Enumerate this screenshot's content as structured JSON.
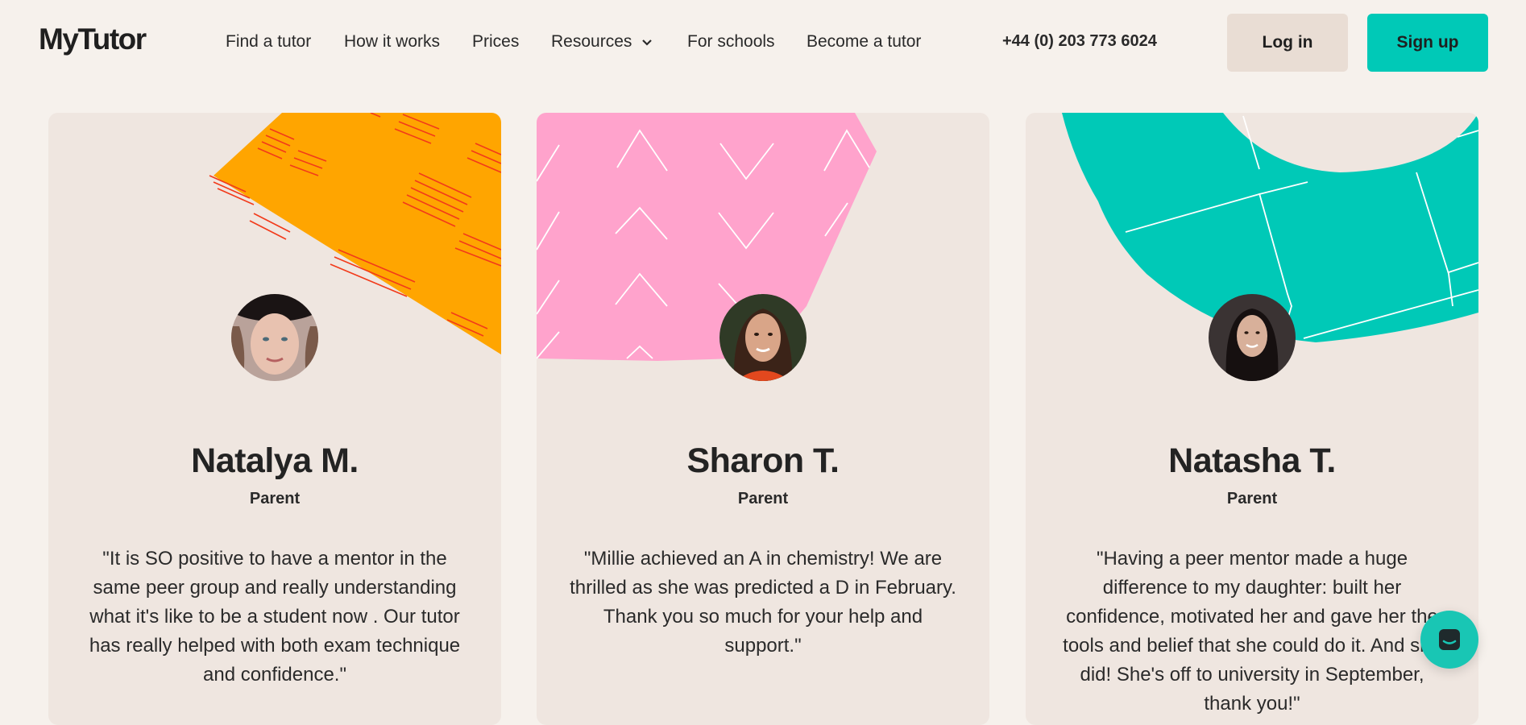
{
  "header": {
    "logo": "MyTutor",
    "nav": [
      {
        "label": "Find a tutor"
      },
      {
        "label": "How it works"
      },
      {
        "label": "Prices"
      },
      {
        "label": "Resources"
      },
      {
        "label": "For schools"
      },
      {
        "label": "Become a tutor"
      }
    ],
    "phone": "+44 (0) 203 773 6024",
    "login_label": "Log in",
    "signup_label": "Sign up"
  },
  "testimonials": [
    {
      "name": "Natalya M.",
      "role": "Parent",
      "quote": "\"It is SO positive to have a mentor in the same peer group and really understanding what it's like to be a student now . Our tutor has really helped with both exam technique and confidence.\"",
      "accent": "#ffa500"
    },
    {
      "name": "Sharon T.",
      "role": "Parent",
      "quote": "\"Millie achieved an A in chemistry! We are thrilled as she was predicted a D in February. Thank you so much for your help and support.\"",
      "accent": "#ffa3cc"
    },
    {
      "name": "Natasha T.",
      "role": "Parent",
      "quote": "\"Having a peer mentor made a huge difference to my daughter: built her confidence, motivated her and gave her the tools and belief that she could do it. And she did! She's off to university in September, thank you!\"",
      "accent": "#00c9b7"
    }
  ],
  "chat": {
    "icon": "chat-icon"
  },
  "colors": {
    "background": "#f6f1ec",
    "card": "#efe6e0",
    "brand_teal": "#00c9b7",
    "login_bg": "#e9ddd4"
  }
}
